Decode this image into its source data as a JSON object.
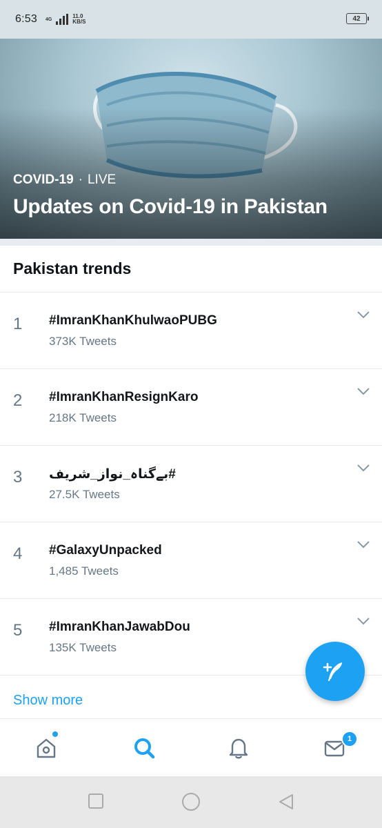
{
  "status_bar": {
    "time": "6:53",
    "network": "4G",
    "speed_value": "11.0",
    "speed_unit": "KB/S",
    "battery": "42"
  },
  "hero": {
    "category": "COVID-19",
    "separator": "·",
    "status": "LIVE",
    "title": "Updates on Covid-19 in Pakistan"
  },
  "trends": {
    "header": "Pakistan trends",
    "items": [
      {
        "rank": "1",
        "name": "#ImranKhanKhulwaoPUBG",
        "count": "373K Tweets"
      },
      {
        "rank": "2",
        "name": "#ImranKhanResignKaro",
        "count": "218K Tweets"
      },
      {
        "rank": "3",
        "name": "#بےگناہ_نواز_شریف",
        "count": "27.5K Tweets"
      },
      {
        "rank": "4",
        "name": "#GalaxyUnpacked",
        "count": "1,485 Tweets"
      },
      {
        "rank": "5",
        "name": "#ImranKhanJawabDou",
        "count": "135K Tweets"
      }
    ],
    "show_more": "Show more"
  },
  "bottom_nav": {
    "active": "search",
    "messages_badge": "1",
    "icons": [
      "home-icon",
      "search-icon",
      "bell-icon",
      "mail-icon"
    ]
  },
  "colors": {
    "accent": "#1da1f2",
    "secondary_text": "#657786",
    "divider": "#e6ecf0"
  }
}
